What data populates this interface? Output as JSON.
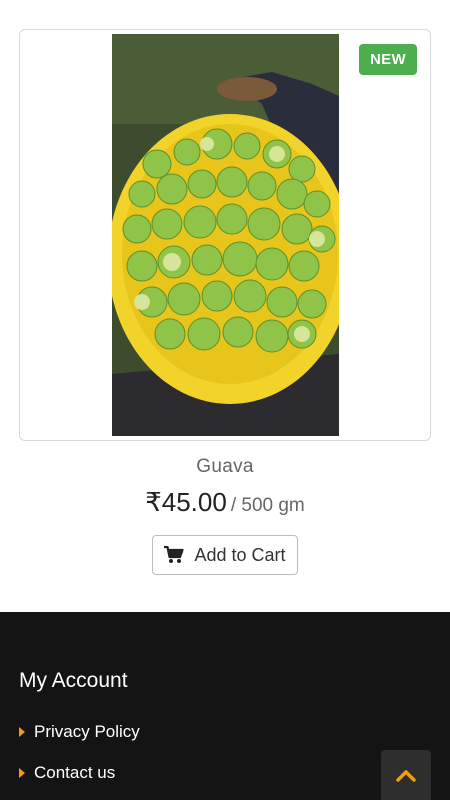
{
  "product": {
    "badge": "NEW",
    "name": "Guava",
    "price": "₹45.00",
    "unit": "/ 500 gm",
    "add_to_cart_label": "Add to Cart"
  },
  "footer": {
    "heading": "My Account",
    "links": [
      {
        "label": "Privacy Policy"
      },
      {
        "label": "Contact us"
      }
    ]
  },
  "icons": {
    "cart": "shopping-cart-icon",
    "caret": "caret-right-icon",
    "scroll_top": "chevron-up-icon"
  },
  "colors": {
    "badge": "#4cae4c",
    "footer_bg": "#141414",
    "accent": "#f39c12"
  }
}
